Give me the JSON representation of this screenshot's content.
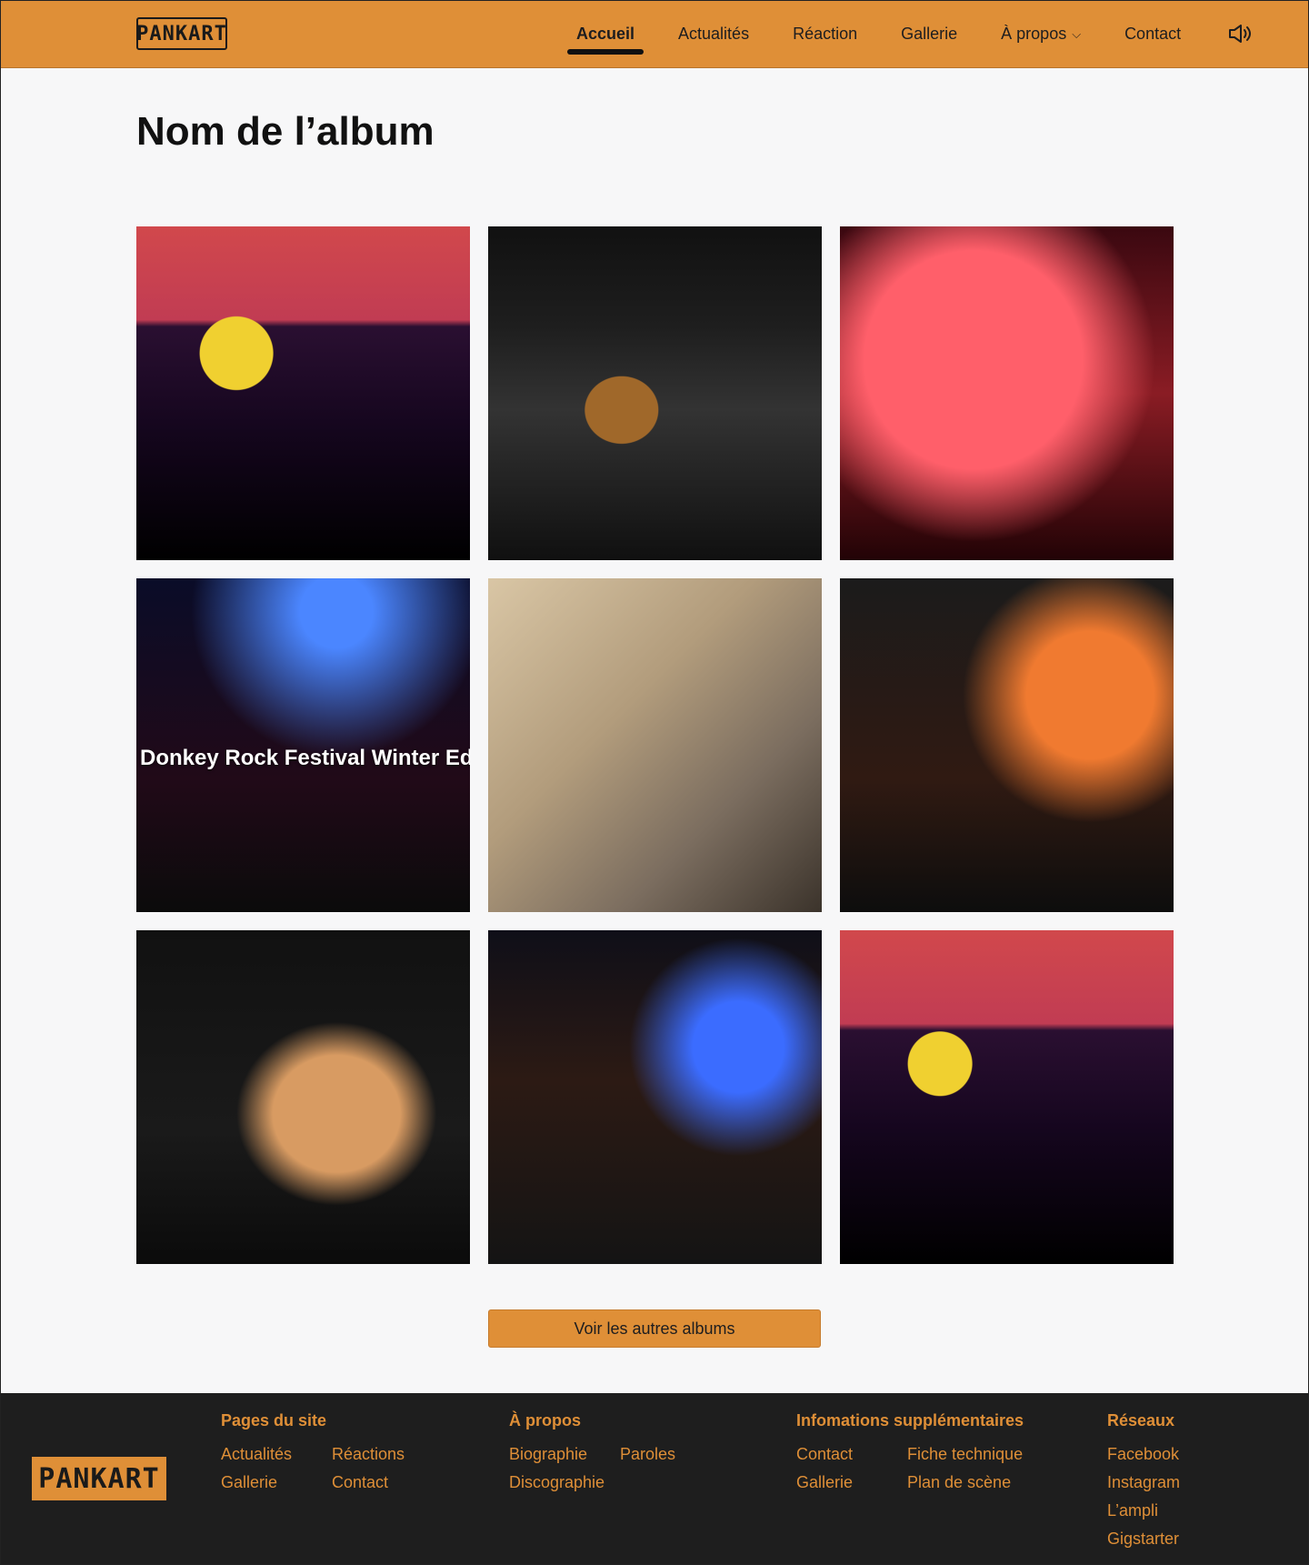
{
  "header": {
    "logo_text": "PANKART",
    "nav": [
      {
        "label": "Accueil",
        "active": true
      },
      {
        "label": "Actualités",
        "active": false
      },
      {
        "label": "Réaction",
        "active": false
      },
      {
        "label": "Gallerie",
        "active": false
      },
      {
        "label": "À propos",
        "active": false,
        "dropdown": true
      },
      {
        "label": "Contact",
        "active": false
      }
    ],
    "sound_icon": "speaker-icon"
  },
  "page": {
    "title": "Nom de l’album",
    "photos": [
      {
        "caption": ""
      },
      {
        "caption": ""
      },
      {
        "caption": ""
      },
      {
        "caption": "Donkey Rock Festival Winter Ed"
      },
      {
        "caption": ""
      },
      {
        "caption": ""
      },
      {
        "caption": ""
      },
      {
        "caption": ""
      },
      {
        "caption": ""
      }
    ],
    "cta_label": "Voir les autres albums"
  },
  "footer": {
    "logo_text": "PANKART",
    "pages_du_site": {
      "heading": "Pages du site",
      "links": [
        "Actualités",
        "Réactions",
        "Gallerie",
        "Contact"
      ]
    },
    "a_propos": {
      "heading": "À propos",
      "links": [
        "Biographie",
        "Paroles",
        "Discographie"
      ]
    },
    "infos": {
      "heading": "Infomations supplémentaires",
      "links": [
        "Contact",
        "Fiche technique",
        "Gallerie",
        "Plan de scène"
      ]
    },
    "reseaux": {
      "heading": "Réseaux",
      "links": [
        "Facebook",
        "Instagram",
        "L’ampli",
        "Gigstarter"
      ]
    }
  },
  "colors": {
    "accent": "#df8f37",
    "footer_bg": "#1e1e1e",
    "page_bg": "#f7f7f8"
  }
}
